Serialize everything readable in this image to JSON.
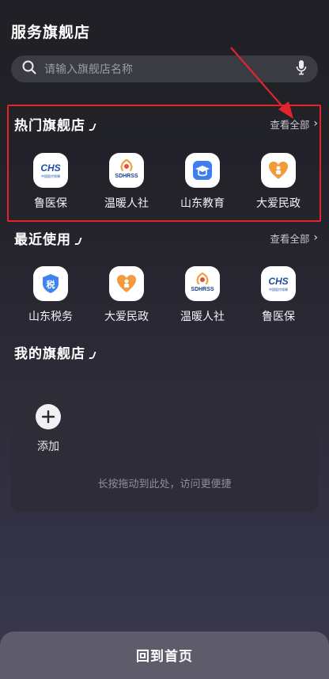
{
  "page": {
    "title": "服务旗舰店"
  },
  "search": {
    "placeholder": "请输入旗舰店名称",
    "icon": "search-icon",
    "voice_icon": "microphone-icon"
  },
  "hot": {
    "title": "热门旗舰店",
    "see_all": "查看全部",
    "items": [
      {
        "label": "鲁医保",
        "icon": "chs-logo-icon",
        "icon_text": "CHS",
        "icon_sub": "中国医疗保障"
      },
      {
        "label": "温暖人社",
        "icon": "sdhrss-logo-icon",
        "icon_text": "SDHRSS"
      },
      {
        "label": "山东教育",
        "icon": "graduation-cap-icon"
      },
      {
        "label": "大爱民政",
        "icon": "heart-people-icon"
      }
    ]
  },
  "recent": {
    "title": "最近使用",
    "see_all": "查看全部",
    "items": [
      {
        "label": "山东税务",
        "icon": "tax-shield-icon",
        "icon_text": "税"
      },
      {
        "label": "大爱民政",
        "icon": "heart-people-icon"
      },
      {
        "label": "温暖人社",
        "icon": "sdhrss-logo-icon",
        "icon_text": "SDHRSS"
      },
      {
        "label": "鲁医保",
        "icon": "chs-logo-icon",
        "icon_text": "CHS",
        "icon_sub": "中国医疗保障"
      }
    ]
  },
  "mine": {
    "title": "我的旗舰店",
    "add_label": "添加",
    "hint": "长按拖动到此处，访问更便捷"
  },
  "footer": {
    "home_button": "回到首页"
  },
  "colors": {
    "highlight_border": "#e3242b",
    "annotation_arrow": "#e3242b",
    "chs_blue": "#1c4fa3",
    "sdhrss_orange": "#f2a23a",
    "edu_blue": "#3f7ef0",
    "minzheng_orange": "#f39a3d",
    "tax_blue": "#3d84f0"
  }
}
